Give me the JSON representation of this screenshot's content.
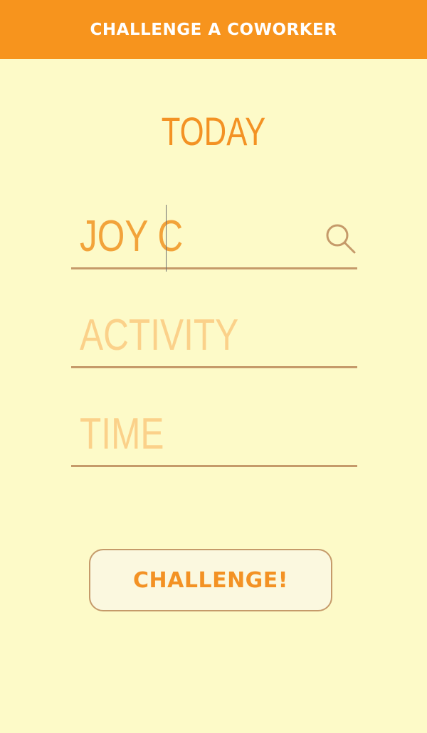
{
  "header": {
    "title": "CHALLENGE A COWORKER"
  },
  "date_label": "TODAY",
  "form": {
    "coworker": {
      "value": "JOY C",
      "icon": "search-icon"
    },
    "activity": {
      "placeholder": "ACTIVITY"
    },
    "time": {
      "placeholder": "TIME"
    }
  },
  "challenge_button": {
    "label": "CHALLENGE!"
  },
  "colors": {
    "header_bg": "#f7941d",
    "page_bg": "#fdfac8",
    "accent": "#f39224",
    "placeholder": "#fbd18a",
    "underline": "#c59a6a"
  }
}
